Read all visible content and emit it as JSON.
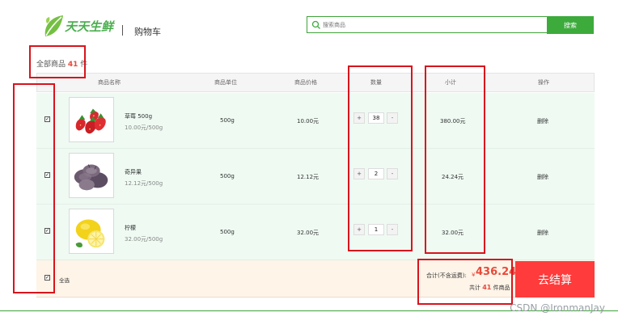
{
  "header": {
    "logo_text": "天天生鲜",
    "separator": "|",
    "page_title": "购物车"
  },
  "search": {
    "placeholder": "搜索商品",
    "button_label": "搜索"
  },
  "summary_top": {
    "prefix": "全部商品",
    "count": "41",
    "suffix": "件"
  },
  "table": {
    "headers": [
      "商品名称",
      "商品单位",
      "商品价格",
      "数量",
      "小计",
      "操作"
    ]
  },
  "items": [
    {
      "name": "草莓 500g",
      "unit_price": "10.00元/500g",
      "unit": "500g",
      "price": "10.00元",
      "qty": "38",
      "subtotal": "380.00元",
      "action": "删除",
      "plus": "+",
      "minus": "-",
      "checked": "✓"
    },
    {
      "name": "奇异果",
      "unit_price": "12.12元/500g",
      "unit": "500g",
      "price": "12.12元",
      "qty": "2",
      "subtotal": "24.24元",
      "action": "删除",
      "plus": "+",
      "minus": "-",
      "checked": "✓"
    },
    {
      "name": "柠檬",
      "unit_price": "32.00元/500g",
      "unit": "500g",
      "price": "32.00元",
      "qty": "1",
      "subtotal": "32.00元",
      "action": "删除",
      "plus": "+",
      "minus": "-",
      "checked": "✓"
    }
  ],
  "footer": {
    "select_all": "全选",
    "select_all_check": "✓",
    "total_label": "合计(不含运费):",
    "currency": "¥",
    "total_value": "436.24",
    "count_prefix": "共计",
    "count_value": "41",
    "count_suffix": "件商品",
    "checkout_label": "去结算"
  },
  "watermark": "CSDN @IronmanJay",
  "colors": {
    "brand_green": "#3cab3c",
    "row_bg": "#effaf3",
    "footer_bg": "#fef4e8",
    "checkout_red": "#ff3b3b",
    "annotation_red": "#d8141c",
    "price_red": "#e84a3a"
  },
  "icons": [
    "logo-leaf-icon",
    "search-icon",
    "strawberry-image",
    "kiwi-image",
    "lemon-image"
  ]
}
